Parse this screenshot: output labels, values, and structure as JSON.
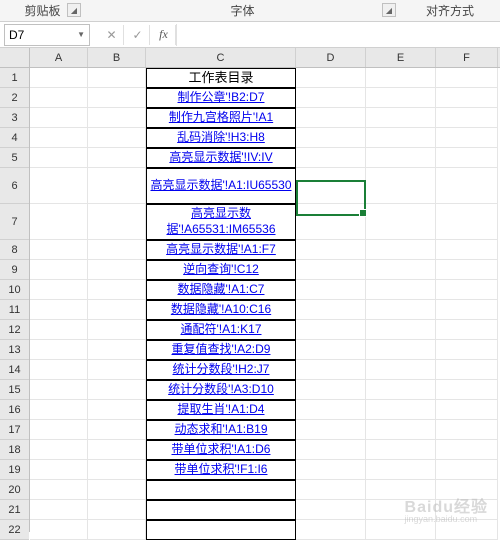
{
  "ribbon": {
    "group1_label": "剪贴板",
    "group2_label": "字体",
    "group3_label": "对齐方式"
  },
  "namebox": {
    "value": "D7"
  },
  "fx": {
    "cancel": "✕",
    "confirm": "✓",
    "fx": "fx"
  },
  "columns": [
    "A",
    "B",
    "C",
    "D",
    "E",
    "F"
  ],
  "row_numbers": [
    "1",
    "2",
    "3",
    "4",
    "5",
    "6",
    "7",
    "8",
    "9",
    "10",
    "11",
    "12",
    "13",
    "14",
    "15",
    "16",
    "17",
    "18",
    "19",
    "20",
    "21",
    "22"
  ],
  "tall_rows": [
    6,
    7
  ],
  "c_cells": {
    "1": "工作表目录",
    "2": "制作公章'!B2:D7",
    "3": "制作九宫格照片'!A1",
    "4": "乱码消除'!H3:H8",
    "5": "高亮显示数据'!IV:IV",
    "6": "高亮显示数据'!A1:IU65530",
    "7": "高亮显示数据'!A65531:IM65536",
    "8": "高亮显示数据'!A1:F7",
    "9": "逆向查询'!C12",
    "10": "数据隐藏'!A1:C7",
    "11": "数据隐藏'!A10:C16",
    "12": "通配符'!A1:K17",
    "13": "重复值查找'!A2:D9",
    "14": "统计分数段'!H2:J7",
    "15": "统计分数段'!A3:D10",
    "16": "提取生肖'!A1:D4",
    "17": "动态求和'!A1:B19",
    "18": "带单位求积'!A1:D6",
    "19": "带单位求积'!F1:I6"
  },
  "watermark": {
    "main": "Baidu经验",
    "sub": "jingyan.baidu.com"
  }
}
